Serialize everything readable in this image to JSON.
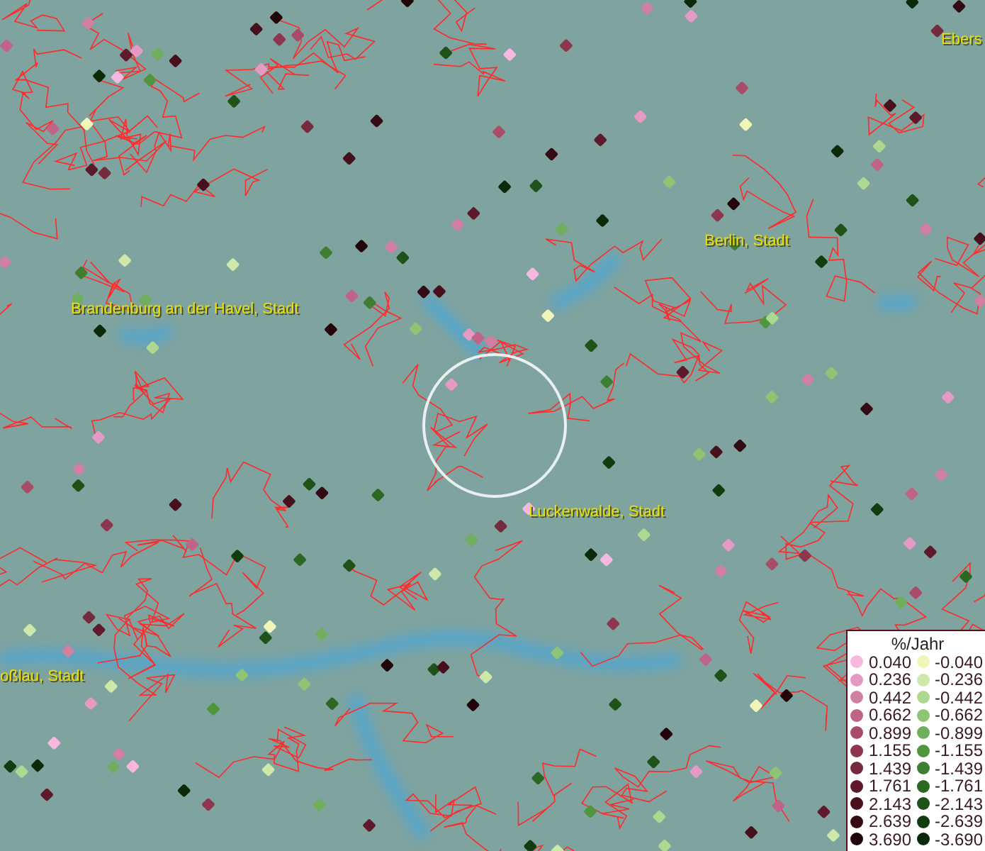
{
  "map": {
    "place_labels": [
      {
        "text": "Ebers"
      },
      {
        "text": "Berlin, Stadt"
      },
      {
        "text": "Brandenburg an der Havel, Stadt"
      },
      {
        "text": "Luckenwalde, Stadt"
      },
      {
        "text": "oßlau, Stadt"
      }
    ]
  },
  "legend": {
    "title": "%/Jahr",
    "rows": [
      {
        "positive": {
          "label": "0.040",
          "color": "#f7b8e0"
        },
        "negative": {
          "label": "-0.040",
          "color": "#f0f5b8"
        }
      },
      {
        "positive": {
          "label": "0.236",
          "color": "#e59ac3"
        },
        "negative": {
          "label": "-0.236",
          "color": "#cde8a8"
        }
      },
      {
        "positive": {
          "label": "0.442",
          "color": "#d27fa4"
        },
        "negative": {
          "label": "-0.442",
          "color": "#aed88f"
        }
      },
      {
        "positive": {
          "label": "0.662",
          "color": "#bf6487"
        },
        "negative": {
          "label": "-0.662",
          "color": "#8fc474"
        }
      },
      {
        "positive": {
          "label": "0.899",
          "color": "#a84c6a"
        },
        "negative": {
          "label": "-0.899",
          "color": "#6fae5c"
        }
      },
      {
        "positive": {
          "label": "1.155",
          "color": "#8e3550"
        },
        "negative": {
          "label": "-1.155",
          "color": "#50963f"
        }
      },
      {
        "positive": {
          "label": "1.439",
          "color": "#752a3d"
        },
        "negative": {
          "label": "-1.439",
          "color": "#3d7e30"
        }
      },
      {
        "positive": {
          "label": "1.761",
          "color": "#5e1a2a"
        },
        "negative": {
          "label": "-1.761",
          "color": "#2b6823"
        }
      },
      {
        "positive": {
          "label": "2.143",
          "color": "#48101c"
        },
        "negative": {
          "label": "-2.143",
          "color": "#1e5219"
        }
      },
      {
        "positive": {
          "label": "2.639",
          "color": "#340a14"
        },
        "negative": {
          "label": "-2.639",
          "color": "#123c10"
        }
      },
      {
        "positive": {
          "label": "3.690",
          "color": "#22050a"
        },
        "negative": {
          "label": "-3.690",
          "color": "#0a2a09"
        }
      }
    ]
  }
}
